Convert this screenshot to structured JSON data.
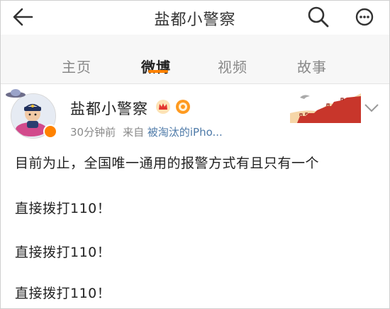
{
  "navbar": {
    "title": "盐都小警察",
    "back_icon": "back-arrow-icon",
    "search_icon": "search-icon",
    "more_icon": "more-dots-icon"
  },
  "tabs": [
    {
      "label": "主页",
      "active": false
    },
    {
      "label": "微博",
      "active": true
    },
    {
      "label": "视频",
      "active": false
    },
    {
      "label": "故事",
      "active": false
    }
  ],
  "colors": {
    "accent": "#ff8200",
    "link": "#4e7aa8",
    "meta": "#8a8a8a"
  },
  "post": {
    "user_name": "盐都小警察",
    "time": "30分钟前",
    "from_label": "来自",
    "source": "被淘汰的iPho...",
    "lines": [
      "目前为止，全国唯一通用的报警方式有且只有一个",
      "直接拨打110！",
      "直接拨打110！",
      "直接拨打110！"
    ]
  }
}
